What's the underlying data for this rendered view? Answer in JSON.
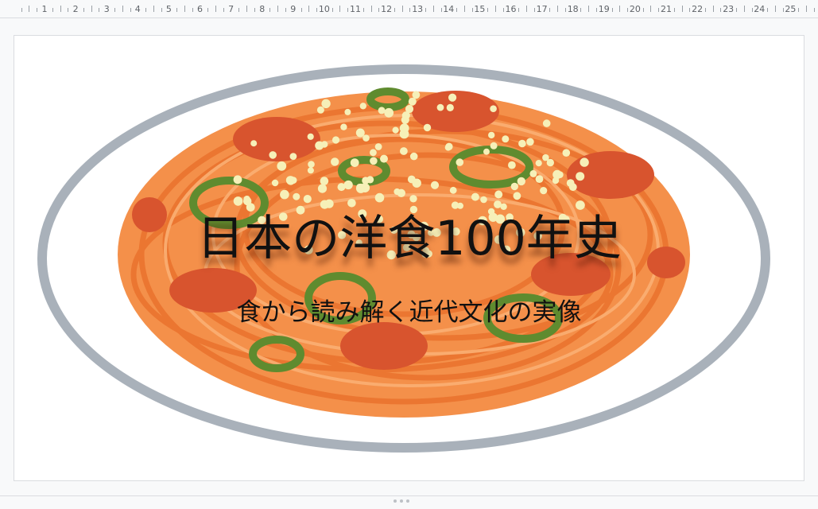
{
  "ruler": {
    "numbers": [
      "1",
      "2",
      "3",
      "4",
      "5",
      "6",
      "7",
      "8",
      "9",
      "10",
      "11",
      "12",
      "13",
      "14",
      "15",
      "16",
      "17",
      "18",
      "19",
      "20",
      "21",
      "22",
      "23",
      "24",
      "25"
    ]
  },
  "slide": {
    "title": "日本の洋食100年史",
    "subtitle": "食から読み解く近代文化の実像",
    "image_icon": "spaghetti-napolitan-illustration"
  },
  "colors": {
    "plate_rim": "#a9b1ba",
    "pasta": "#f2873a",
    "sauce": "#d8542e",
    "pepper": "#5f8b2f",
    "cheese": "#f6f0b8"
  }
}
